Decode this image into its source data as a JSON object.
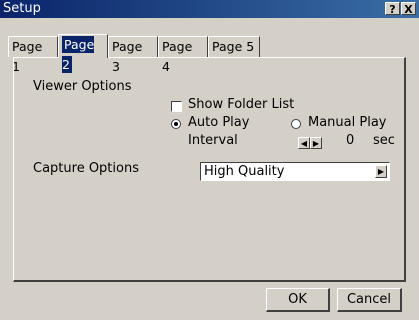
{
  "window": {
    "title": "Setup",
    "help_label": "?",
    "close_label": "X"
  },
  "tabs": [
    {
      "label": "Page 1",
      "active": false
    },
    {
      "label": "Page 2",
      "active": true
    },
    {
      "label": "Page 3",
      "active": false
    },
    {
      "label": "Page 4",
      "active": false
    },
    {
      "label": "Page 5",
      "active": false
    }
  ],
  "viewer_options": {
    "heading": "Viewer Options",
    "show_folder_list": {
      "label": "Show Folder List",
      "checked": false
    },
    "auto_play": {
      "label": "Auto Play",
      "selected": true
    },
    "manual_play": {
      "label": "Manual Play",
      "selected": false
    },
    "interval": {
      "label": "Interval",
      "value": "0",
      "unit": "sec"
    }
  },
  "capture_options": {
    "heading": "Capture Options",
    "selected": "High Quality"
  },
  "buttons": {
    "ok": "OK",
    "cancel": "Cancel"
  },
  "colors": {
    "titlebar": "#0a246a",
    "face": "#d4d0c8",
    "selection": "#0a246a"
  }
}
